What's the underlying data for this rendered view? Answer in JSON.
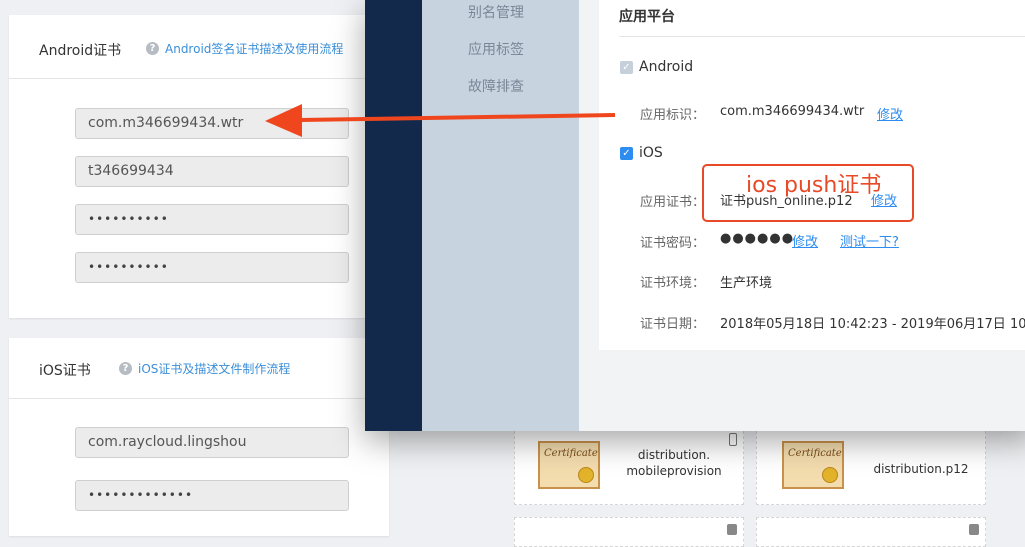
{
  "android_card": {
    "title": "Android证书",
    "help_link": "Android签名证书描述及使用流程",
    "fields": [
      "com.m346699434.wtr",
      "t346699434",
      "••••••••••",
      "••••••••••"
    ]
  },
  "ios_card": {
    "title": "iOS证书",
    "help_link": "iOS证书及描述文件制作流程",
    "fields": [
      "com.raycloud.lingshou",
      "•••••••••••••"
    ]
  },
  "popup": {
    "nav_items": [
      "别名管理",
      "应用标签",
      "故障排查"
    ],
    "section_title": "应用平台",
    "android": {
      "label": "Android",
      "app_id_label": "应用标识：",
      "app_id_value": "com.m346699434.wtr",
      "edit": "修改"
    },
    "ios": {
      "label": "iOS",
      "cert_label": "应用证书：",
      "cert_value": "证书push_online.p12",
      "cert_edit": "修改",
      "pw_label": "证书密码：",
      "pw_value": "●●●●●●",
      "pw_edit": "修改",
      "pw_test": "测试一下?",
      "env_label": "证书环境：",
      "env_value": "生产环境",
      "date_label": "证书日期：",
      "date_value": "2018年05月18日 10:42:23 - 2019年06月17日 10:4"
    }
  },
  "annotation": {
    "text": "ios push证书",
    "color": "#e84a28"
  },
  "files": [
    {
      "name_line1": "distribution.",
      "name_line2": "mobileprovision",
      "cert_word": "Certificate"
    },
    {
      "name": "distribution.p12",
      "cert_word": "Certificate"
    }
  ],
  "colors": {
    "accent": "#2d8cf0",
    "annotation": "#e84a28",
    "sidebar_dark": "#13294b"
  }
}
